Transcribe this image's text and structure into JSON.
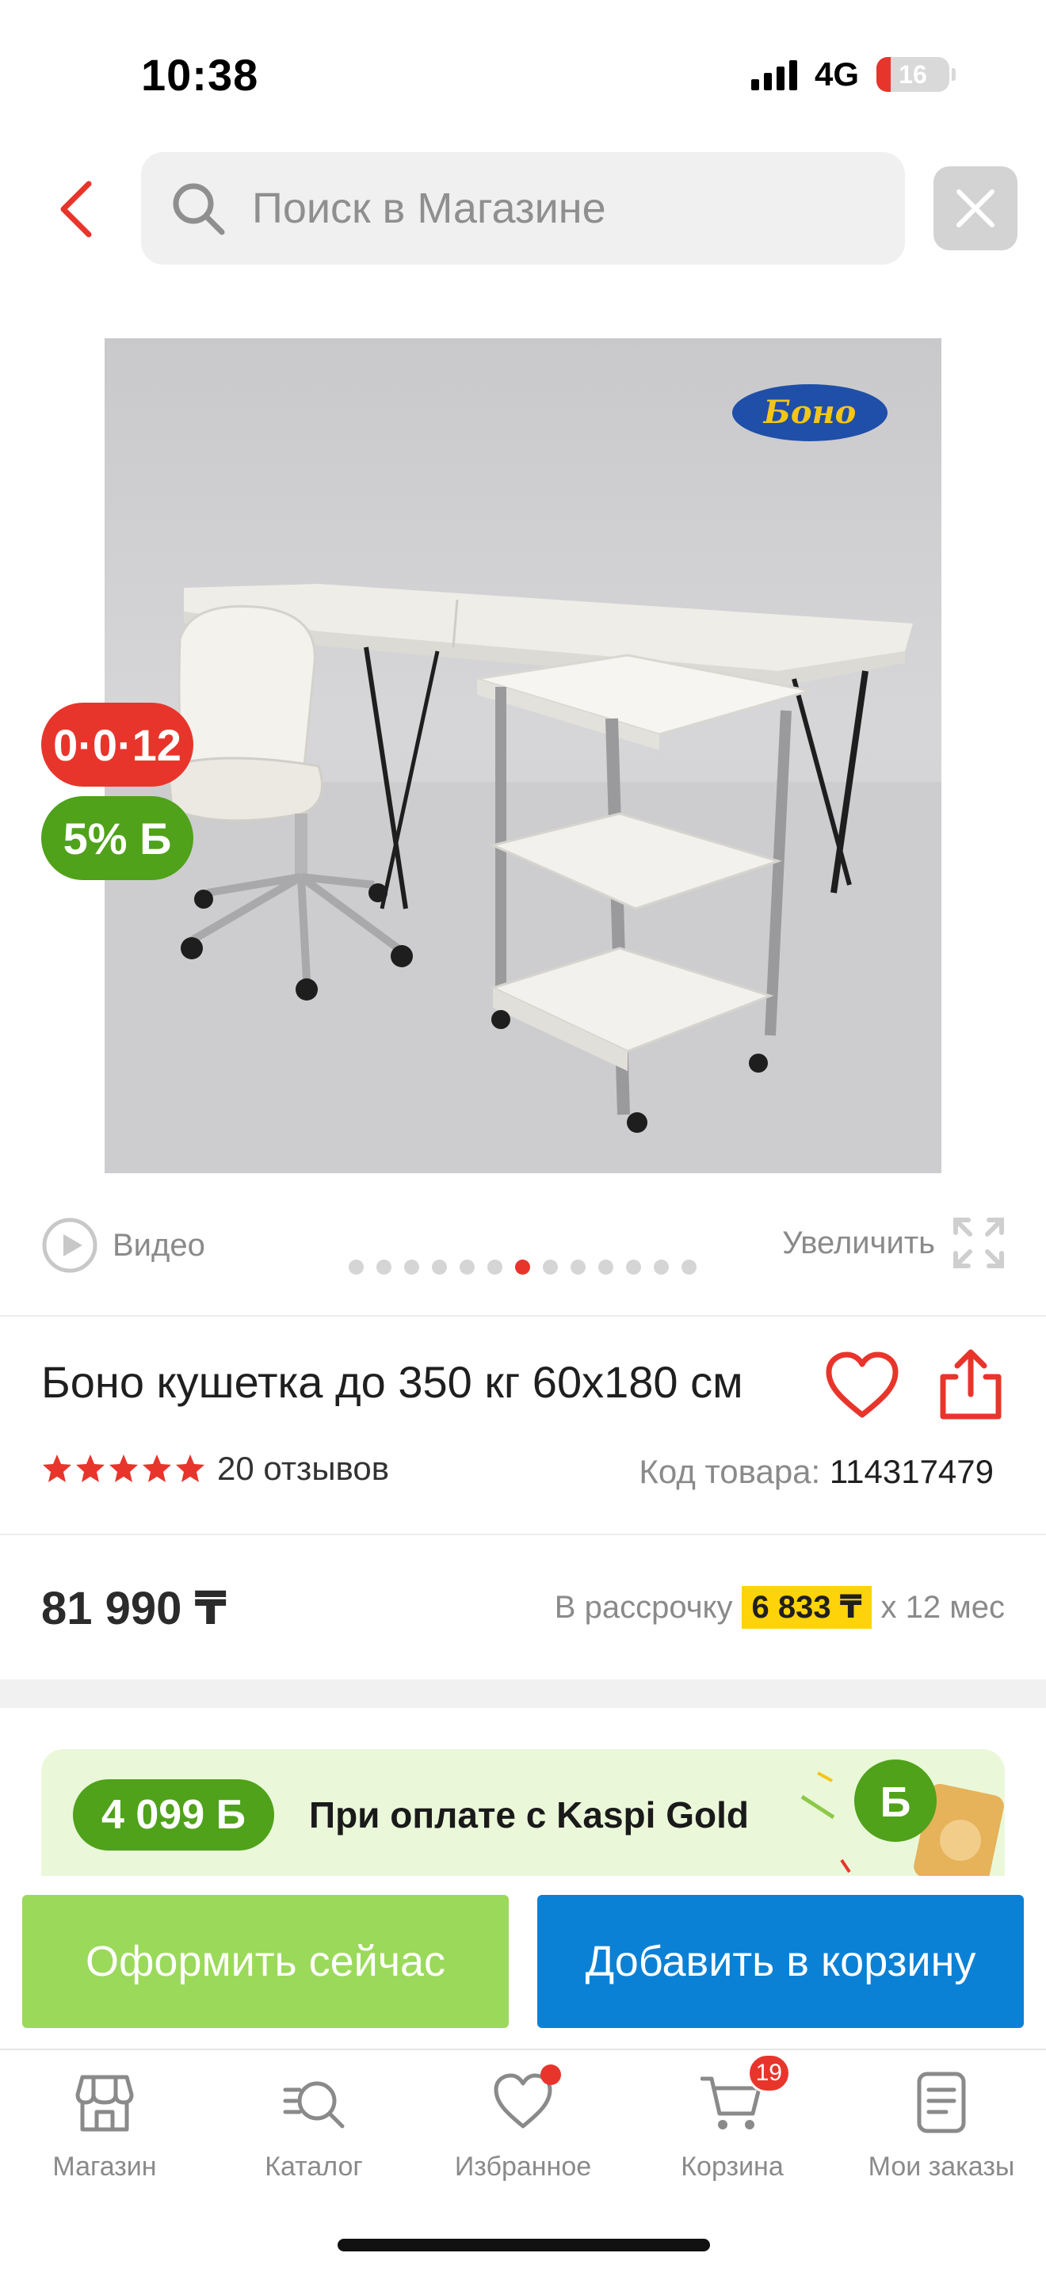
{
  "status_bar": {
    "time": "10:38",
    "network": "4G",
    "battery": "16"
  },
  "search": {
    "placeholder": "Поиск в Магазине"
  },
  "product": {
    "brand_logo_text": "Боно",
    "badges": {
      "installment": "0·0·12",
      "bonus": "5% Б"
    },
    "video_label": "Видео",
    "zoom_label": "Увеличить",
    "gallery": {
      "total": 13,
      "active_index": 6
    },
    "title": "Боно кушетка до 350 кг 60x180 см",
    "rating": 5,
    "reviews": "20 отзывов",
    "sku_label": "Код товара:",
    "sku_value": "114317479",
    "price": "81 990 ₸",
    "credit_prefix": "В рассрочку",
    "credit_amount": "6 833 ₸",
    "credit_suffix": "x 12 мес"
  },
  "promo": {
    "bonus": "4 099 Б",
    "text": "При оплате с Kaspi Gold"
  },
  "actions": {
    "checkout": "Оформить сейчас",
    "add_to_cart": "Добавить в корзину"
  },
  "nav": {
    "items": [
      {
        "label": "Магазин"
      },
      {
        "label": "Каталог"
      },
      {
        "label": "Избранное"
      },
      {
        "label": "Корзина",
        "badge": "19"
      },
      {
        "label": "Мои заказы"
      }
    ]
  },
  "colors": {
    "accent_red": "#e8352c",
    "bonus_green": "#4fa21a",
    "primary_blue": "#0b81d6",
    "checkout_green": "#9bd95a",
    "highlight_yellow": "#ffd30a"
  }
}
